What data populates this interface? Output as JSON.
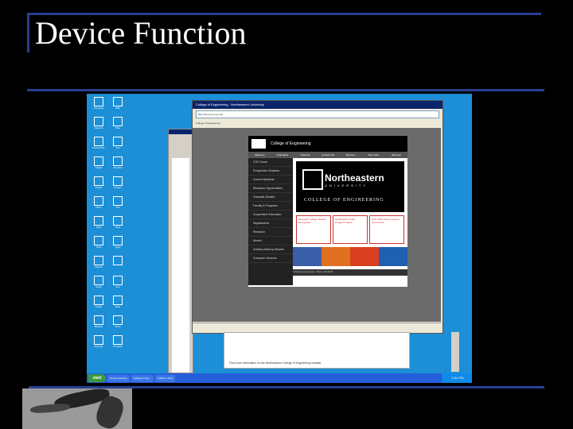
{
  "slide": {
    "title": "Device Function"
  },
  "screenshot": {
    "desktop_icons": [
      {
        "label": "Computer"
      },
      {
        "label": "PDF"
      },
      {
        "label": "Network"
      },
      {
        "label": "Files"
      },
      {
        "label": "Documents"
      },
      {
        "label": "Text"
      },
      {
        "label": "Folder"
      },
      {
        "label": "Shortcut"
      },
      {
        "label": "Folder"
      },
      {
        "label": "Project"
      },
      {
        "label": "Drive"
      },
      {
        "label": "File"
      },
      {
        "label": "Data"
      },
      {
        "label": "Files"
      },
      {
        "label": "Tools"
      },
      {
        "label": "Apps"
      },
      {
        "label": "Report"
      },
      {
        "label": ""
      },
      {
        "label": "Notes"
      },
      {
        "label": "Text"
      },
      {
        "label": "Folder"
      },
      {
        "label": "Files"
      },
      {
        "label": "Backup"
      },
      {
        "label": "Docs"
      },
      {
        "label": "Recycle"
      },
      {
        "label": "Program"
      }
    ],
    "browser": {
      "window_title": "College of Engineering - Northeastern University",
      "address": "http://www.coe.neu.edu",
      "tab": "College of Engineering",
      "site": {
        "header": "College of Engineering",
        "nav": [
          "Welcome",
          "COE News",
          "Calendar",
          "Contact Info",
          "Directory",
          "Site Index",
          "Webmail"
        ],
        "menu": [
          "COE Home",
          "Prospective Students",
          "Current Students",
          "Research Opportunities",
          "Graduate Studies",
          "Faculty & Programs",
          "Cooperative Education",
          "Departments",
          "Research",
          "Alumni",
          "Industry Advisory Boards",
          "Computer Services"
        ],
        "hero": {
          "name": "Northeastern",
          "university": "UNIVERSITY",
          "college": "COLLEGE OF ENGINEERING"
        },
        "news": [
          {
            "text": "Research College Student Recognition"
          },
          {
            "text": "Northeastern COE Programs News"
          },
          {
            "text": "New COE Online Courses Announced"
          }
        ],
        "footer": "COE Engineering Center - Boston, MA 02115"
      }
    },
    "lower_message": "Find more information on the Northeastern College of Engineering website.",
    "taskbar": {
      "start": "start",
      "tasks": [
        {
          "label": "Device Function"
        },
        {
          "label": "College of Eng..."
        },
        {
          "label": "Untitled - Paint"
        }
      ],
      "clock": "3:04 PM"
    }
  }
}
